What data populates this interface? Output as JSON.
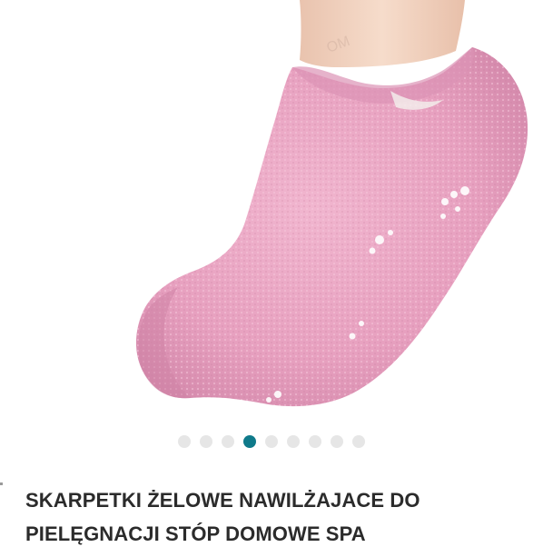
{
  "product": {
    "title": "SKARPETKI ŻELOWE NAWILŻAJACE DO PIELĘGNACJI STÓP DOMOWE SPA",
    "image_alt": "Pink gel moisturizing sock on a foot",
    "watermark": "OM"
  },
  "carousel": {
    "total": 9,
    "active_index": 3,
    "active_color": "#0f7a8a",
    "inactive_color": "#e6e6e6"
  },
  "colors": {
    "sock_pink": "#e9a3c0",
    "sock_shadow": "#cc7fa2",
    "skin": "#f3d3c1",
    "text": "#2b2b2b"
  }
}
